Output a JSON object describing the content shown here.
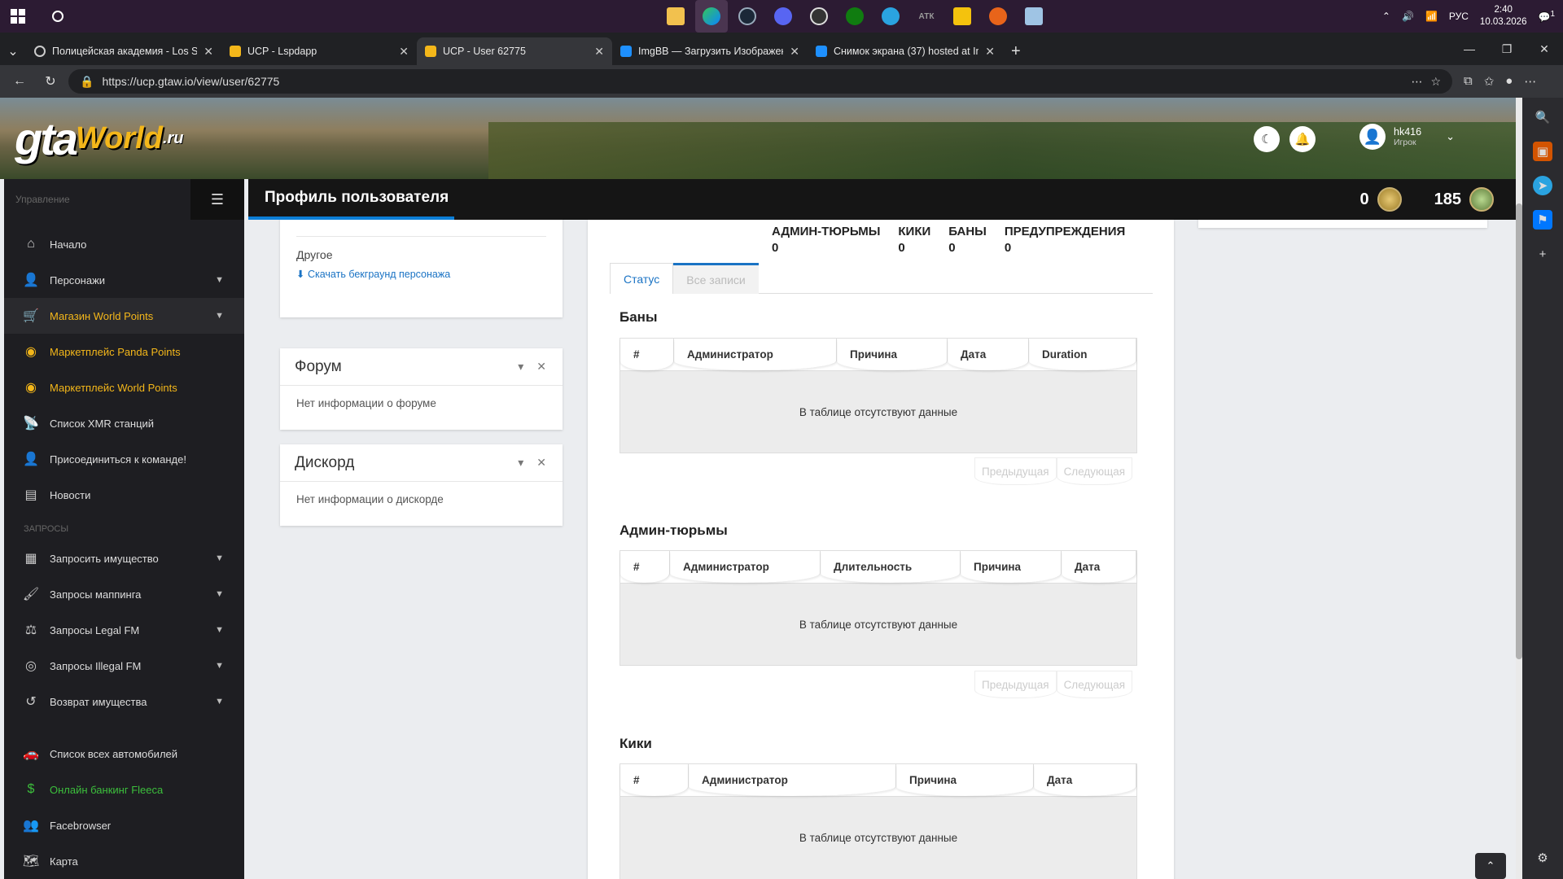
{
  "taskbar": {
    "clock_time": "2:40",
    "clock_date": "10.03.2026",
    "lang": "РУС",
    "notif_count": "1",
    "app_letters": "АТК"
  },
  "tabs": [
    {
      "title": "Полицейская академия - Los San...",
      "fav_color": "#8ab4f8"
    },
    {
      "title": "UCP - Lspdapp",
      "fav_color": "#f4b71a"
    },
    {
      "title": "UCP - User 62775",
      "fav_color": "#f4b71a"
    },
    {
      "title": "ImgBB — Загрузить Изображени...",
      "fav_color": "#1e90ff"
    },
    {
      "title": "Снимок экрана (37) hosted at Img...",
      "fav_color": "#1e90ff"
    }
  ],
  "address": {
    "url": "https://ucp.gtaw.io/view/user/62775"
  },
  "brand": {
    "gta": "gta",
    "world": "World",
    "ru": ".ru"
  },
  "user": {
    "name": "hk416",
    "role": "Игрок"
  },
  "sidebar": {
    "header": "Управление",
    "section_requests": "ЗАПРОСЫ",
    "items": [
      {
        "label": "Начало",
        "icon": "home-icon"
      },
      {
        "label": "Персонажи",
        "icon": "user-icon"
      },
      {
        "label": "Магазин World Points",
        "icon": "cart-icon"
      },
      {
        "label": "Маркетплейс Panda Points",
        "icon": "coins-icon"
      },
      {
        "label": "Маркетплейс World Points",
        "icon": "coins-icon"
      },
      {
        "label": "Список XMR станций",
        "icon": "antenna-icon"
      },
      {
        "label": "Присоединиться к команде!",
        "icon": "user-plus-icon"
      },
      {
        "label": "Новости",
        "icon": "news-icon"
      }
    ],
    "request_items": [
      {
        "label": "Запросить имущество",
        "icon": "building-icon"
      },
      {
        "label": "Запросы маппинга",
        "icon": "brush-icon"
      },
      {
        "label": "Запросы Legal FM",
        "icon": "scales-icon"
      },
      {
        "label": "Запросы Illegal FM",
        "icon": "mask-icon"
      },
      {
        "label": "Возврат имущества",
        "icon": "undo-icon"
      }
    ],
    "bottom_items": [
      {
        "label": "Список всех автомобилей",
        "icon": "car-icon"
      },
      {
        "label": "Онлайн банкинг Fleeca",
        "icon": "money-icon"
      },
      {
        "label": "Facebrowser",
        "icon": "users-icon"
      },
      {
        "label": "Карта",
        "icon": "map-icon"
      }
    ]
  },
  "topbar": {
    "title": "Профиль пользователя",
    "points_a": "0",
    "points_b": "185"
  },
  "left_cards": {
    "other_title": "Другое",
    "download_label": "Скачать бекграунд персонажа",
    "forum_title": "Форум",
    "forum_body": "Нет информации о форуме",
    "discord_title": "Дискорд",
    "discord_body": "Нет информации о дискорде"
  },
  "stats": [
    {
      "label": "АДМИН-ТЮРЬМЫ",
      "value": "0"
    },
    {
      "label": "КИКИ",
      "value": "0"
    },
    {
      "label": "БАНЫ",
      "value": "0"
    },
    {
      "label": "ПРЕДУПРЕЖДЕНИЯ",
      "value": "0"
    }
  ],
  "profile_tabs": {
    "status": "Статус",
    "all": "Все записи"
  },
  "tables": {
    "empty_text": "В таблице отсутствуют данные",
    "prev": "Предыдущая",
    "next": "Следующая",
    "bans": {
      "title": "Баны",
      "cols": [
        "#",
        "Администратор",
        "Причина",
        "Дата",
        "Duration"
      ]
    },
    "jails": {
      "title": "Админ-тюрьмы",
      "cols": [
        "#",
        "Администратор",
        "Длительность",
        "Причина",
        "Дата"
      ]
    },
    "kicks": {
      "title": "Кики",
      "cols": [
        "#",
        "Администратор",
        "Причина",
        "Дата"
      ]
    }
  }
}
